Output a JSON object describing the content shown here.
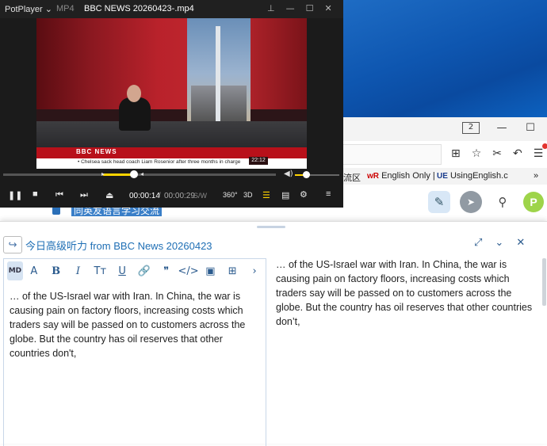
{
  "player": {
    "brand": "PotPlayer",
    "format": "MP4",
    "file_name": "BBC NEWS 20260423-.mp4",
    "video": {
      "channel_logo": "BBC NEWS",
      "ticker": "• Chelsea sack head coach Liam Rosenior after three months in charge",
      "clock": "22:12"
    },
    "seek": {
      "progress": 0.48
    },
    "volume": {
      "level": 0.25
    },
    "time_current": "00:00:14",
    "time_separator": "/",
    "time_total": "00:00:29",
    "sw_label": "S/W",
    "label_360": "360°",
    "label_3d": "3D"
  },
  "browser": {
    "tab_count": "2",
    "bookmarks": [
      {
        "prefix": "",
        "label": "流区"
      },
      {
        "prefix": "wR",
        "label": "English Only |"
      },
      {
        "prefix": "UE",
        "label": "UsingEnglish.c"
      }
    ]
  },
  "site": {
    "partial_title": "同英友语言学习交流",
    "avatar_letter": "P",
    "colors": {
      "avatar": "#9ed44a",
      "link": "#1f6fb5"
    }
  },
  "composer": {
    "title": "今日高级听力 from BBC News 20260423",
    "editor_text": "… of the US-Israel war with Iran. In China, the war is causing pain on factory floors, increasing costs which traders say will be passed on to customers across the globe. But the country has oil reserves that other countries don't,",
    "preview_text": "… of the US-Israel war with Iran. In China, the war is causing pain on factory floors, increasing costs which traders say will be passed on to customers across the globe. But the country has oil reserves that other countries don’t,"
  }
}
